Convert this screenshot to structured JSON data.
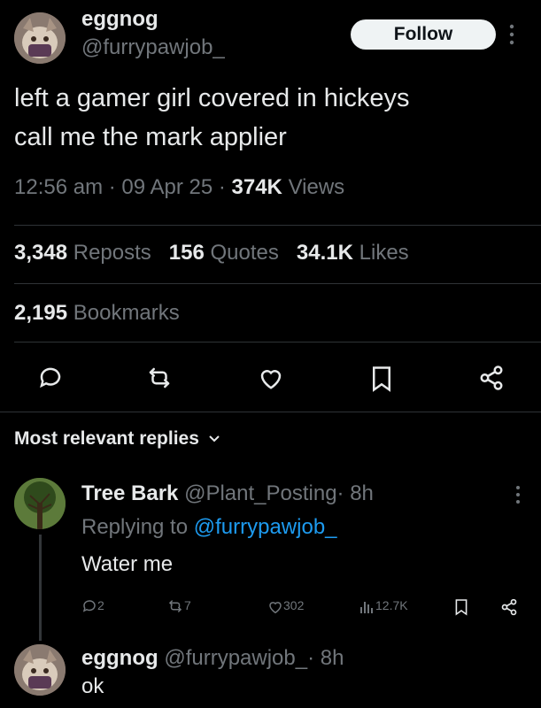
{
  "tweet": {
    "author_name": "eggnog",
    "author_handle": "@furrypawjob_",
    "follow_label": "Follow",
    "text_line1": "left a gamer girl covered in hickeys",
    "text_line2": "call me the mark applier",
    "time": "12:56 am",
    "date": "09 Apr 25",
    "views_count": "374K",
    "views_label": "Views",
    "dot": "·",
    "reposts_count": "3,348",
    "reposts_label": "Reposts",
    "quotes_count": "156",
    "quotes_label": "Quotes",
    "likes_count": "34.1K",
    "likes_label": "Likes",
    "bookmarks_count": "2,195",
    "bookmarks_label": "Bookmarks"
  },
  "replies_header": {
    "label": "Most relevant replies",
    "chevron_icon": "chevron-down-icon"
  },
  "reply1": {
    "author_name": "Tree Bark",
    "author_handle": "@Plant_Posting",
    "time": "· 8h",
    "replying_prefix": "Replying to",
    "replying_to": "@furrypawjob_",
    "text": "Water me",
    "reply_count": "2",
    "repost_count": "7",
    "like_count": "302",
    "views_count": "12.7K"
  },
  "reply2": {
    "author_name": "eggnog",
    "author_handle": "@furrypawjob_",
    "time": "· 8h",
    "text": "ok"
  },
  "colors": {
    "background": "#000000",
    "text": "#e7e9ea",
    "muted": "#71767b",
    "link": "#1d9bf0",
    "divider": "#2f3336"
  }
}
